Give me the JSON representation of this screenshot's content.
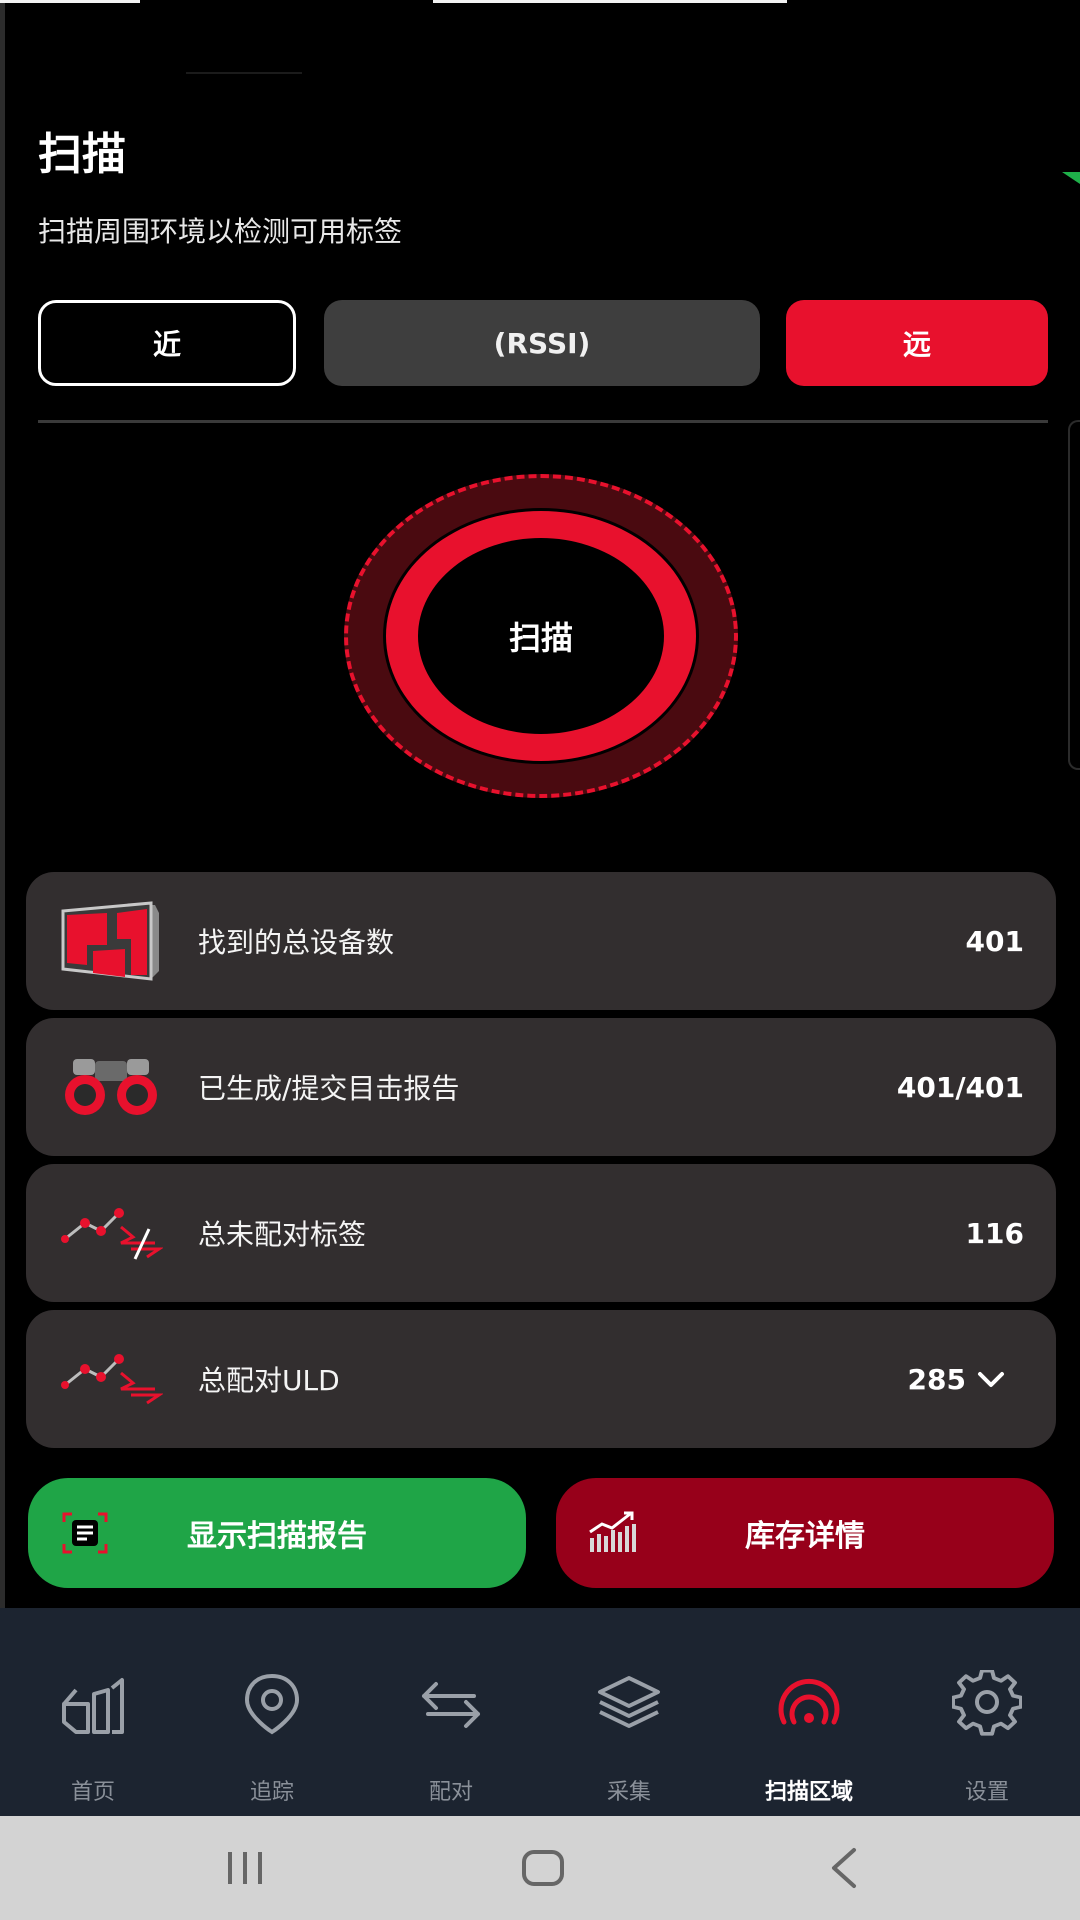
{
  "header": {
    "title": "扫描",
    "subtitle": "扫描周围环境以检测可用标签"
  },
  "range_selector": {
    "near_label": "近",
    "rssi_label": "(RSSI)",
    "far_label": "远",
    "selected": "远"
  },
  "scan_button": {
    "label": "扫描"
  },
  "stats": [
    {
      "label": "找到的总设备数",
      "value": "401",
      "icon": "container-icon"
    },
    {
      "label": "已生成/提交目击报告",
      "value": "401/401",
      "icon": "binoculars-icon"
    },
    {
      "label": "总未配对标签",
      "value": "116",
      "icon": "unpaired-link-icon"
    },
    {
      "label": "总配对ULD",
      "value": "285",
      "icon": "paired-link-icon"
    }
  ],
  "actions": {
    "report_label": "显示扫描报告",
    "stock_label": "库存详情"
  },
  "nav": {
    "items": [
      {
        "label": "首页",
        "icon": "home-icon"
      },
      {
        "label": "追踪",
        "icon": "location-pin-icon"
      },
      {
        "label": "配对",
        "icon": "swap-arrows-icon"
      },
      {
        "label": "采集",
        "icon": "layers-icon"
      },
      {
        "label": "扫描区域",
        "icon": "signal-icon"
      },
      {
        "label": "设置",
        "icon": "gear-icon"
      }
    ],
    "active": "扫描区域"
  },
  "colors": {
    "accent_red": "#e8112d",
    "dark_red": "#97001a",
    "green": "#1fa547",
    "card": "#322e2f",
    "nav_bg": "#1c2430"
  }
}
